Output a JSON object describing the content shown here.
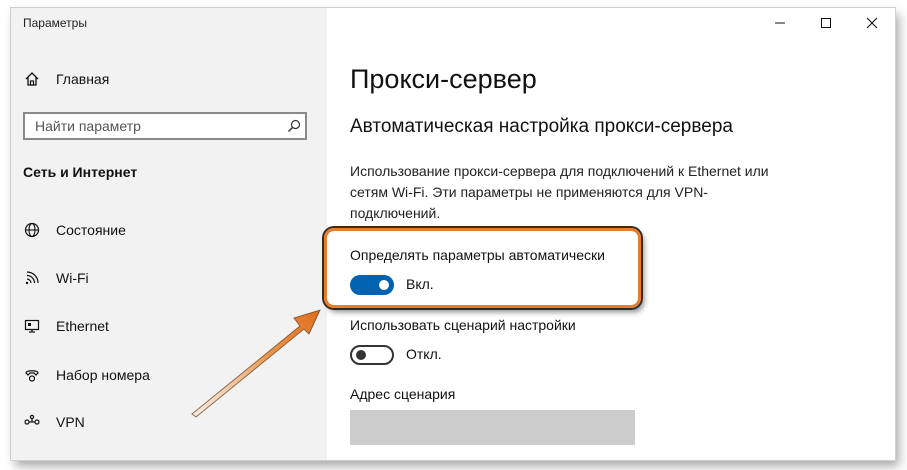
{
  "window": {
    "app_title": "Параметры"
  },
  "sidebar": {
    "home_label": "Главная",
    "search_placeholder": "Найти параметр",
    "section_title": "Сеть и Интернет",
    "items": [
      {
        "label": "Состояние",
        "icon": "globe-icon"
      },
      {
        "label": "Wi-Fi",
        "icon": "wifi-icon"
      },
      {
        "label": "Ethernet",
        "icon": "ethernet-icon"
      },
      {
        "label": "Набор номера",
        "icon": "dialup-icon"
      },
      {
        "label": "VPN",
        "icon": "vpn-icon"
      }
    ]
  },
  "main": {
    "page_title": "Прокси-сервер",
    "subtitle": "Автоматическая настройка прокси-сервера",
    "description": "Использование прокси-сервера для подключений к Ethernet или сетям Wi-Fi. Эти параметры не применяются для VPN-подключений.",
    "auto_detect": {
      "label": "Определять параметры автоматически",
      "state_text": "Вкл.",
      "on": true
    },
    "use_script": {
      "label": "Использовать сценарий настройки",
      "state_text": "Откл.",
      "on": false
    },
    "script_address_label": "Адрес сценария",
    "script_address_value": ""
  },
  "colors": {
    "accent": "#0063b1",
    "highlight": "#e87e2a",
    "sidebar_bg": "#f2f2f2"
  }
}
